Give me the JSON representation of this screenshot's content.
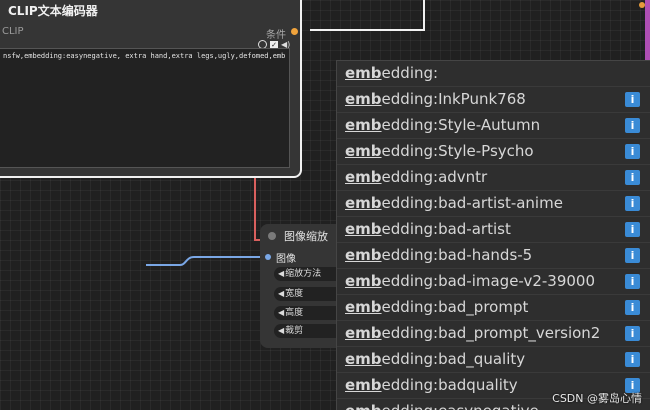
{
  "clip_node": {
    "title": "CLIP文本编码器",
    "input_label": "CLIP",
    "output_label": "条件",
    "prompt_text": "nsfw,embedding:easynegative,  extra hand,extra legs,ugly,defomed,emb",
    "output_color": "#f0a33c"
  },
  "scale_node": {
    "title": "图像缩放",
    "input_label": "图像",
    "fields": [
      "缩放方法",
      "宽度",
      "高度",
      "裁剪"
    ],
    "input_color": "#7aa7e6"
  },
  "autocomplete": {
    "match_prefix": "emb",
    "items": [
      {
        "prefix": "emb",
        "rest": "edding:",
        "info": false
      },
      {
        "prefix": "emb",
        "rest": "edding:InkPunk768",
        "info": true
      },
      {
        "prefix": "emb",
        "rest": "edding:Style-Autumn",
        "info": true
      },
      {
        "prefix": "emb",
        "rest": "edding:Style-Psycho",
        "info": true
      },
      {
        "prefix": "emb",
        "rest": "edding:advntr",
        "info": true
      },
      {
        "prefix": "emb",
        "rest": "edding:bad-artist-anime",
        "info": true
      },
      {
        "prefix": "emb",
        "rest": "edding:bad-artist",
        "info": true
      },
      {
        "prefix": "emb",
        "rest": "edding:bad-hands-5",
        "info": true
      },
      {
        "prefix": "emb",
        "rest": "edding:bad-image-v2-39000",
        "info": true
      },
      {
        "prefix": "emb",
        "rest": "edding:bad_prompt",
        "info": true
      },
      {
        "prefix": "emb",
        "rest": "edding:bad_prompt_version2",
        "info": true
      },
      {
        "prefix": "emb",
        "rest": "edding:bad_quality",
        "info": true
      },
      {
        "prefix": "emb",
        "rest": "edding:badquality",
        "info": true
      },
      {
        "prefix": "emb",
        "rest": "edding:easynegative",
        "info": false
      }
    ],
    "info_icon": "info-icon",
    "info_color": "#3a8bd6"
  },
  "watermark": "CSDN @雾岛心情"
}
